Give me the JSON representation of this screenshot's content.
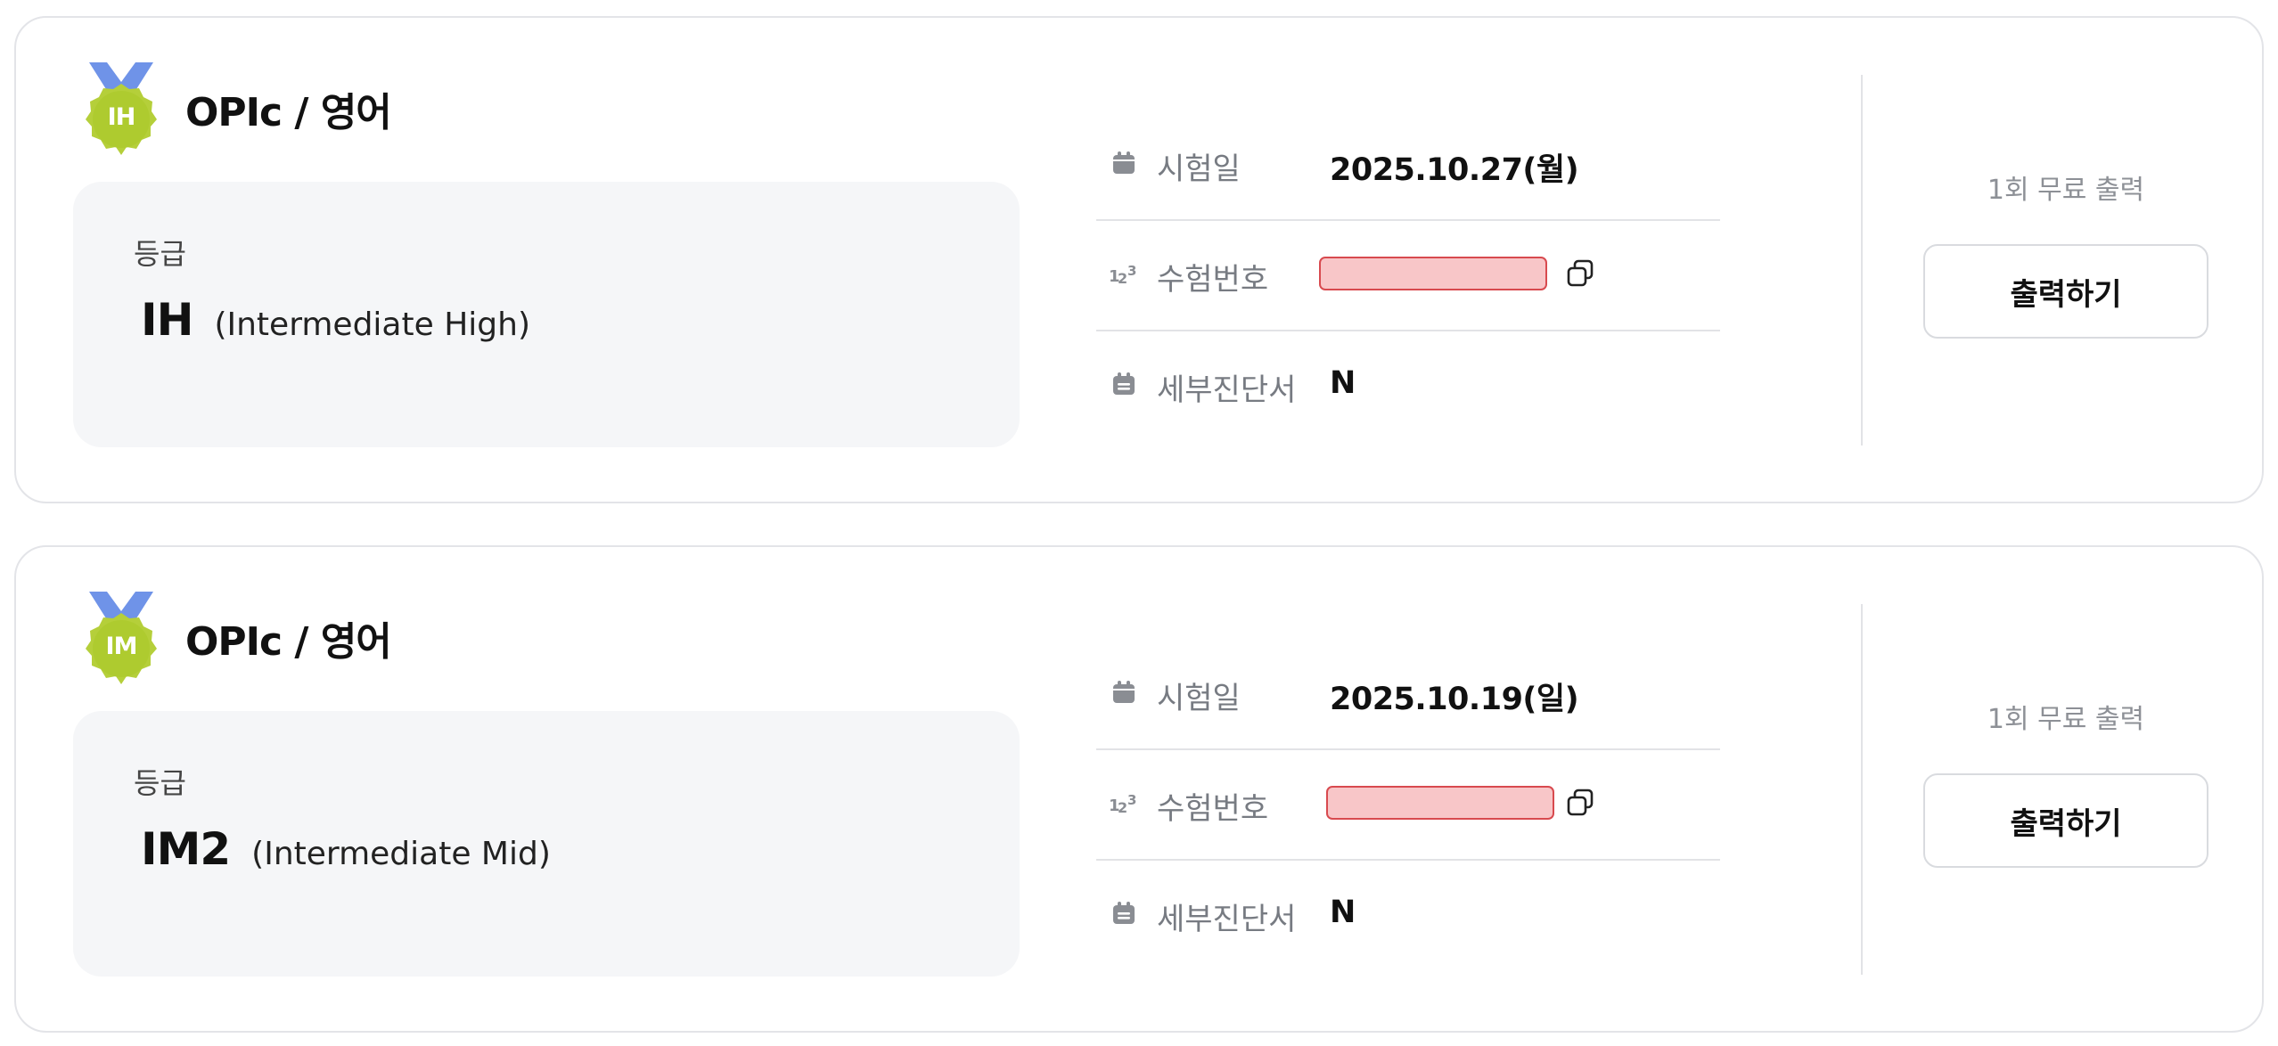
{
  "cards": [
    {
      "badge": "IH",
      "title": "OPIc / 영어",
      "grade_label": "등급",
      "grade_code": "IH",
      "grade_desc": "(Intermediate High)",
      "test_date_label": "시험일",
      "test_date": "2025.10.27(월)",
      "exam_number_label": "수험번호",
      "exam_number": "",
      "detail_label": "세부진단서",
      "detail_value": "N",
      "free_print": "1회 무료 출력",
      "print_button": "출력하기"
    },
    {
      "badge": "IM",
      "title": "OPIc / 영어",
      "grade_label": "등급",
      "grade_code": "IM2",
      "grade_desc": "(Intermediate Mid)",
      "test_date_label": "시험일",
      "test_date": "2025.10.19(일)",
      "exam_number_label": "수험번호",
      "exam_number": "",
      "detail_label": "세부진단서",
      "detail_value": "N",
      "free_print": "1회 무료 출력",
      "print_button": "출력하기"
    }
  ],
  "colors": {
    "medal_green": "#b5cf3a",
    "medal_ribbon": "#6f93e8",
    "redaction_fill": "#f8c6c8",
    "redaction_border": "#d84a4f",
    "border": "#e3e4e8",
    "grade_box_bg": "#f5f6f8"
  },
  "icons": {
    "badge": "medal-icon",
    "test_date": "calendar-icon",
    "exam_number": "numbers-123-icon",
    "detail": "calendar-note-icon",
    "copy": "copy-icon"
  }
}
